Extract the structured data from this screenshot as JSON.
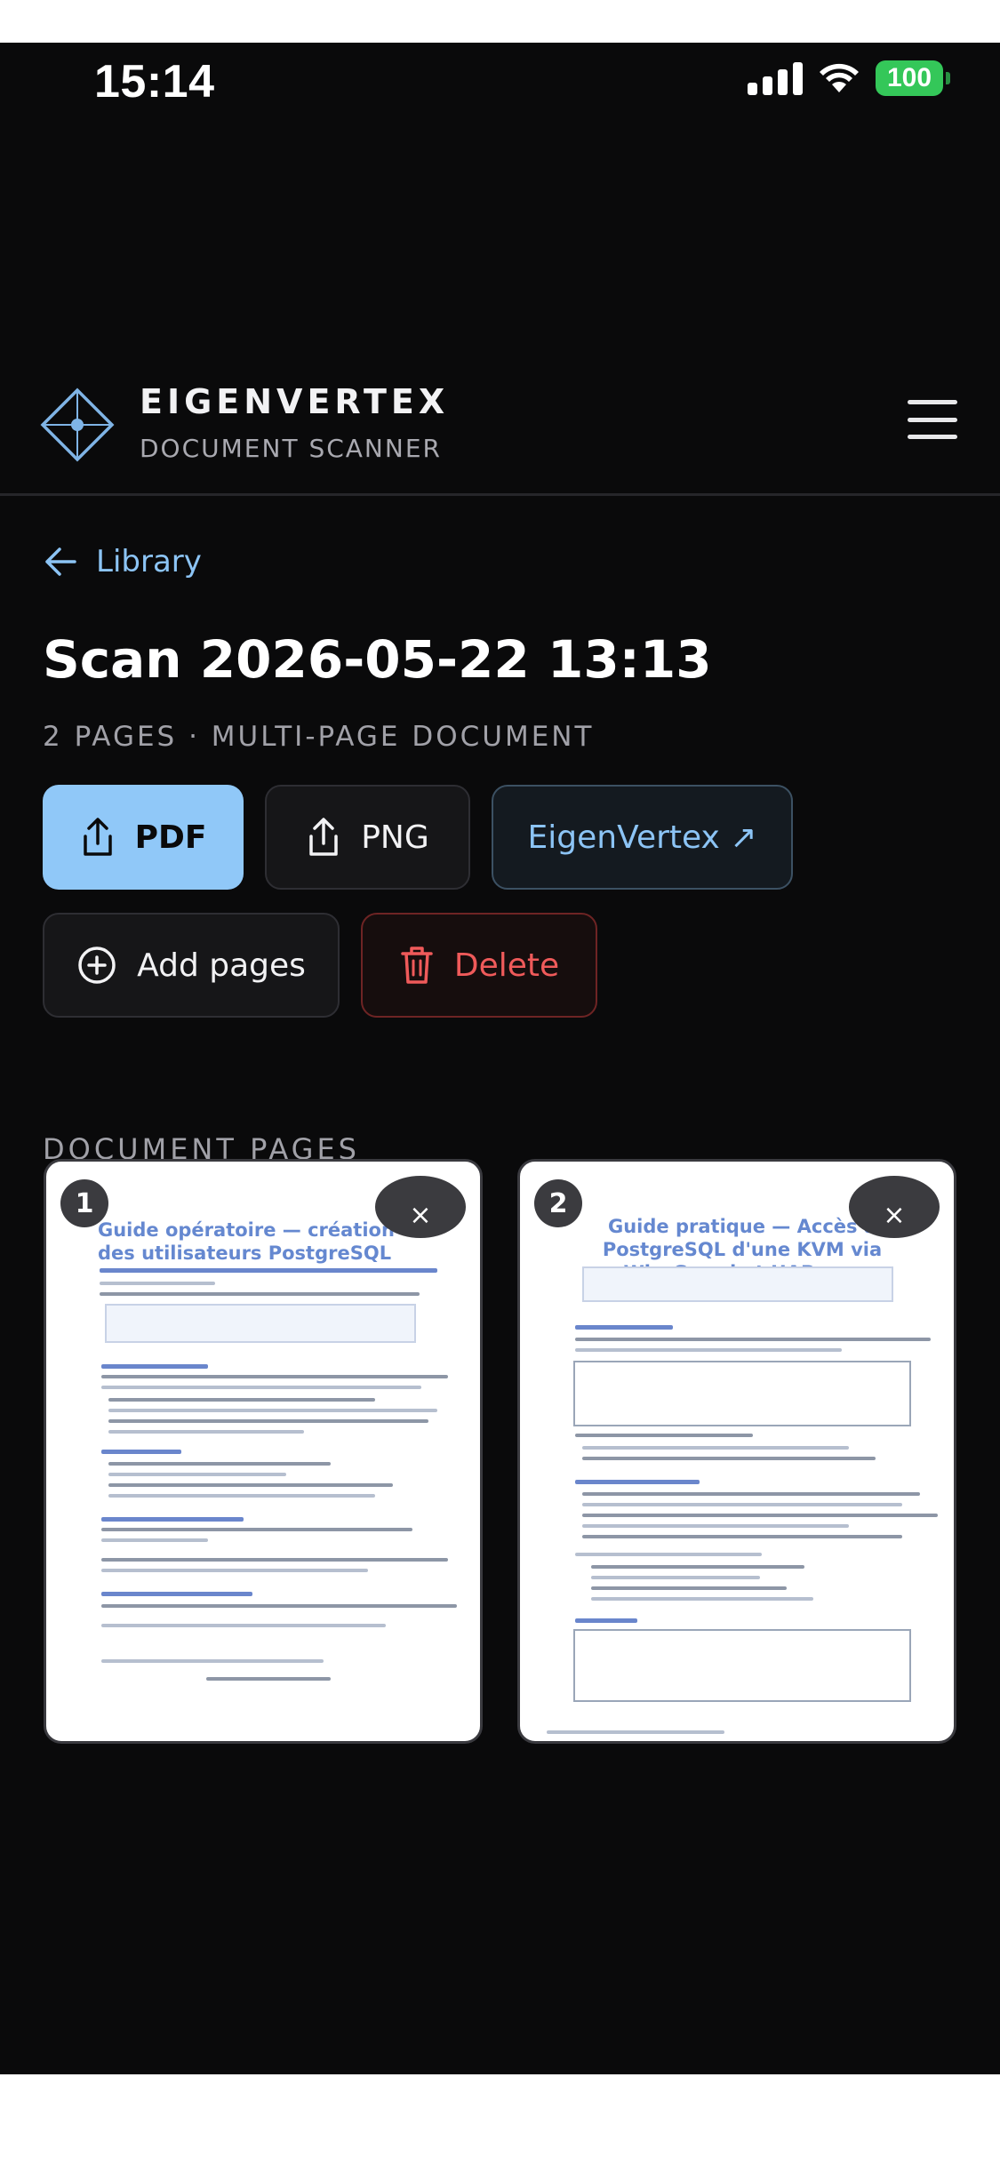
{
  "status_bar": {
    "time": "15:14",
    "battery": "100",
    "icons": [
      "signal-icon",
      "wifi-icon",
      "battery-icon"
    ]
  },
  "header": {
    "brand_name": "EIGENVERTEX",
    "brand_subtitle": "DOCUMENT SCANNER",
    "menu_icon": "hamburger-menu-icon"
  },
  "nav": {
    "back_label": "Library"
  },
  "document": {
    "title": "Scan 2026-05-22 13:13",
    "meta": "2 PAGES · MULTI-PAGE DOCUMENT"
  },
  "actions": {
    "pdf": "PDF",
    "png": "PNG",
    "eigenvertex": "EigenVertex ↗",
    "add_pages": "Add pages",
    "delete": "Delete"
  },
  "pages_section": {
    "label": "DOCUMENT PAGES",
    "remove_glyph": "×",
    "pages": [
      {
        "number": "1",
        "heading": "Guide opératoire — création des utilisateurs PostgreSQL"
      },
      {
        "number": "2",
        "heading": "Guide pratique — Accès à PostgreSQL d'une KVM via WireGuard et HAProxy"
      }
    ]
  },
  "colors": {
    "background": "#0a0a0b",
    "accent": "#90c8f8",
    "link": "#8cc4f5",
    "danger": "#ef5a5a"
  }
}
